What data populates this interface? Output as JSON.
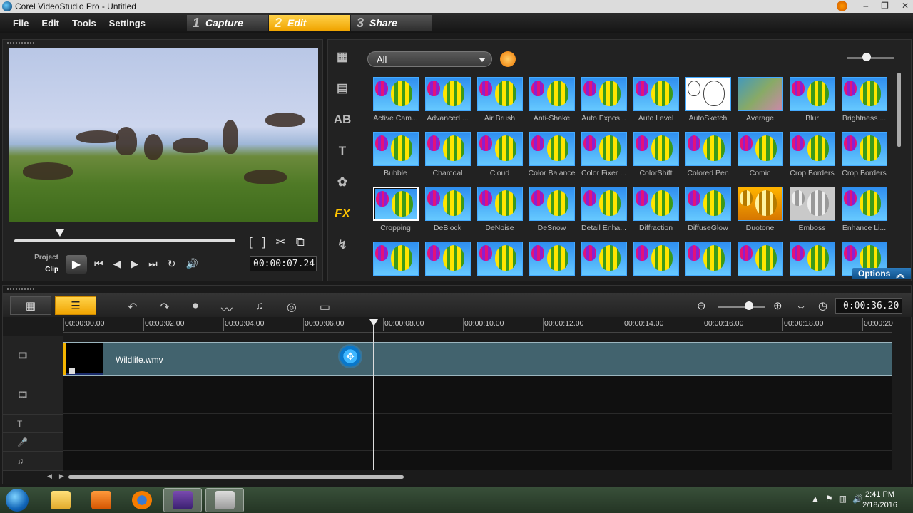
{
  "window": {
    "title": "Corel VideoStudio Pro - Untitled",
    "buttons": [
      "–",
      "❐",
      "✕"
    ]
  },
  "menu": {
    "items": [
      "File",
      "Edit",
      "Tools",
      "Settings"
    ]
  },
  "steps": [
    {
      "num": "1",
      "label": "Capture",
      "active": false
    },
    {
      "num": "2",
      "label": "Edit",
      "active": true
    },
    {
      "num": "3",
      "label": "Share",
      "active": false
    }
  ],
  "preview": {
    "mode_project": "Project",
    "mode_clip": "Clip",
    "timecode": "00:00:07.24",
    "scrub_position": 0.21
  },
  "library": {
    "category_icons": [
      "media-icon",
      "instant-project-icon",
      "transition-icon",
      "title-icon",
      "graphic-icon",
      "fx-icon",
      "path-icon"
    ],
    "filter_value": "All",
    "effects": [
      "Active Cam...",
      "Advanced ...",
      "Air Brush",
      "Anti-Shake",
      "Auto Expos...",
      "Auto Level",
      "AutoSketch",
      "Average",
      "Blur",
      "Brightness ...",
      "Bubble",
      "Charcoal",
      "Cloud",
      "Color Balance",
      "Color Fixer ...",
      "ColorShift",
      "Colored Pen",
      "Comic",
      "Crop Borders",
      "Crop Borders",
      "Cropping",
      "DeBlock",
      "DeNoise",
      "DeSnow",
      "Detail Enha...",
      "Diffraction",
      "DiffuseGlow",
      "Duotone",
      "Emboss",
      "Enhance Li...",
      "",
      "",
      "",
      "",
      "",
      "",
      "",
      "",
      "",
      ""
    ],
    "selected_effect": "Cropping",
    "options_label": "Options"
  },
  "timeline": {
    "project_duration": "0:00:36.20",
    "ruler_ticks": [
      "00:00:00.00",
      "00:00:02.00",
      "00:00:04.00",
      "00:00:06.00",
      "00:00:08.00",
      "00:00:10.00",
      "00:00:12.00",
      "00:00:14.00",
      "00:00:16.00",
      "00:00:18.00",
      "00:00:20"
    ],
    "clip": {
      "name": "Wildlife.wmv"
    },
    "playhead_time": "00:00:07.24"
  },
  "taskbar": {
    "time": "2:41 PM",
    "date": "2/18/2016"
  },
  "colors": {
    "accent": "#f0a400",
    "clip": "#42636e",
    "options": "#0e4f88"
  }
}
